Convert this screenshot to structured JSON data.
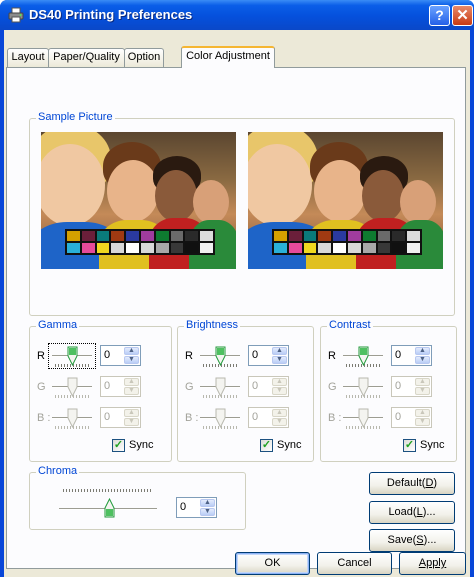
{
  "window": {
    "title": "DS40 Printing Preferences",
    "help_label": "?",
    "close_label": "✕"
  },
  "tabs": [
    "Layout",
    "Paper/Quality",
    "Option",
    "Color Adjustment"
  ],
  "active_tab": "Color Adjustment",
  "sample": {
    "label": "Sample Picture",
    "swatch_colors": [
      "#d4a000",
      "#6b1f3a",
      "#0a7a7a",
      "#a03a12",
      "#2a3aa0",
      "#a03c9e",
      "#0e7a30",
      "#6a6a6a",
      "#2a2a2a",
      "#dcdcdc",
      "#2ab0d8",
      "#e64a9a",
      "#f0d820",
      "#d8d8d8",
      "#ffffff",
      "#d8d8d8",
      "#a8a8a8",
      "#383838",
      "#101010",
      "#f0f0f0"
    ]
  },
  "gamma": {
    "label": "Gamma",
    "rows": [
      {
        "label": "R",
        "value": "0",
        "enabled": true
      },
      {
        "label": "G",
        "value": "0",
        "enabled": false
      },
      {
        "label": "B :",
        "value": "0",
        "enabled": false
      }
    ],
    "sync_label": "Sync",
    "sync_checked": true
  },
  "brightness": {
    "label": "Brightness",
    "rows": [
      {
        "label": "R",
        "value": "0",
        "enabled": true
      },
      {
        "label": "G",
        "value": "0",
        "enabled": false
      },
      {
        "label": "B :",
        "value": "0",
        "enabled": false
      }
    ],
    "sync_label": "Sync",
    "sync_checked": true
  },
  "contrast": {
    "label": "Contrast",
    "rows": [
      {
        "label": "R",
        "value": "0",
        "enabled": true
      },
      {
        "label": "G",
        "value": "0",
        "enabled": false
      },
      {
        "label": "B :",
        "value": "0",
        "enabled": false
      }
    ],
    "sync_label": "Sync",
    "sync_checked": true
  },
  "chroma": {
    "label": "Chroma",
    "value": "0"
  },
  "buttons": {
    "default": {
      "text": "Default(",
      "key": "D",
      "end": ")"
    },
    "load": {
      "text": "Load(",
      "key": "L",
      "end": ")..."
    },
    "save": {
      "text": "Save(",
      "key": "S",
      "end": ")..."
    },
    "ok": "OK",
    "cancel": "Cancel",
    "apply": "Apply"
  }
}
